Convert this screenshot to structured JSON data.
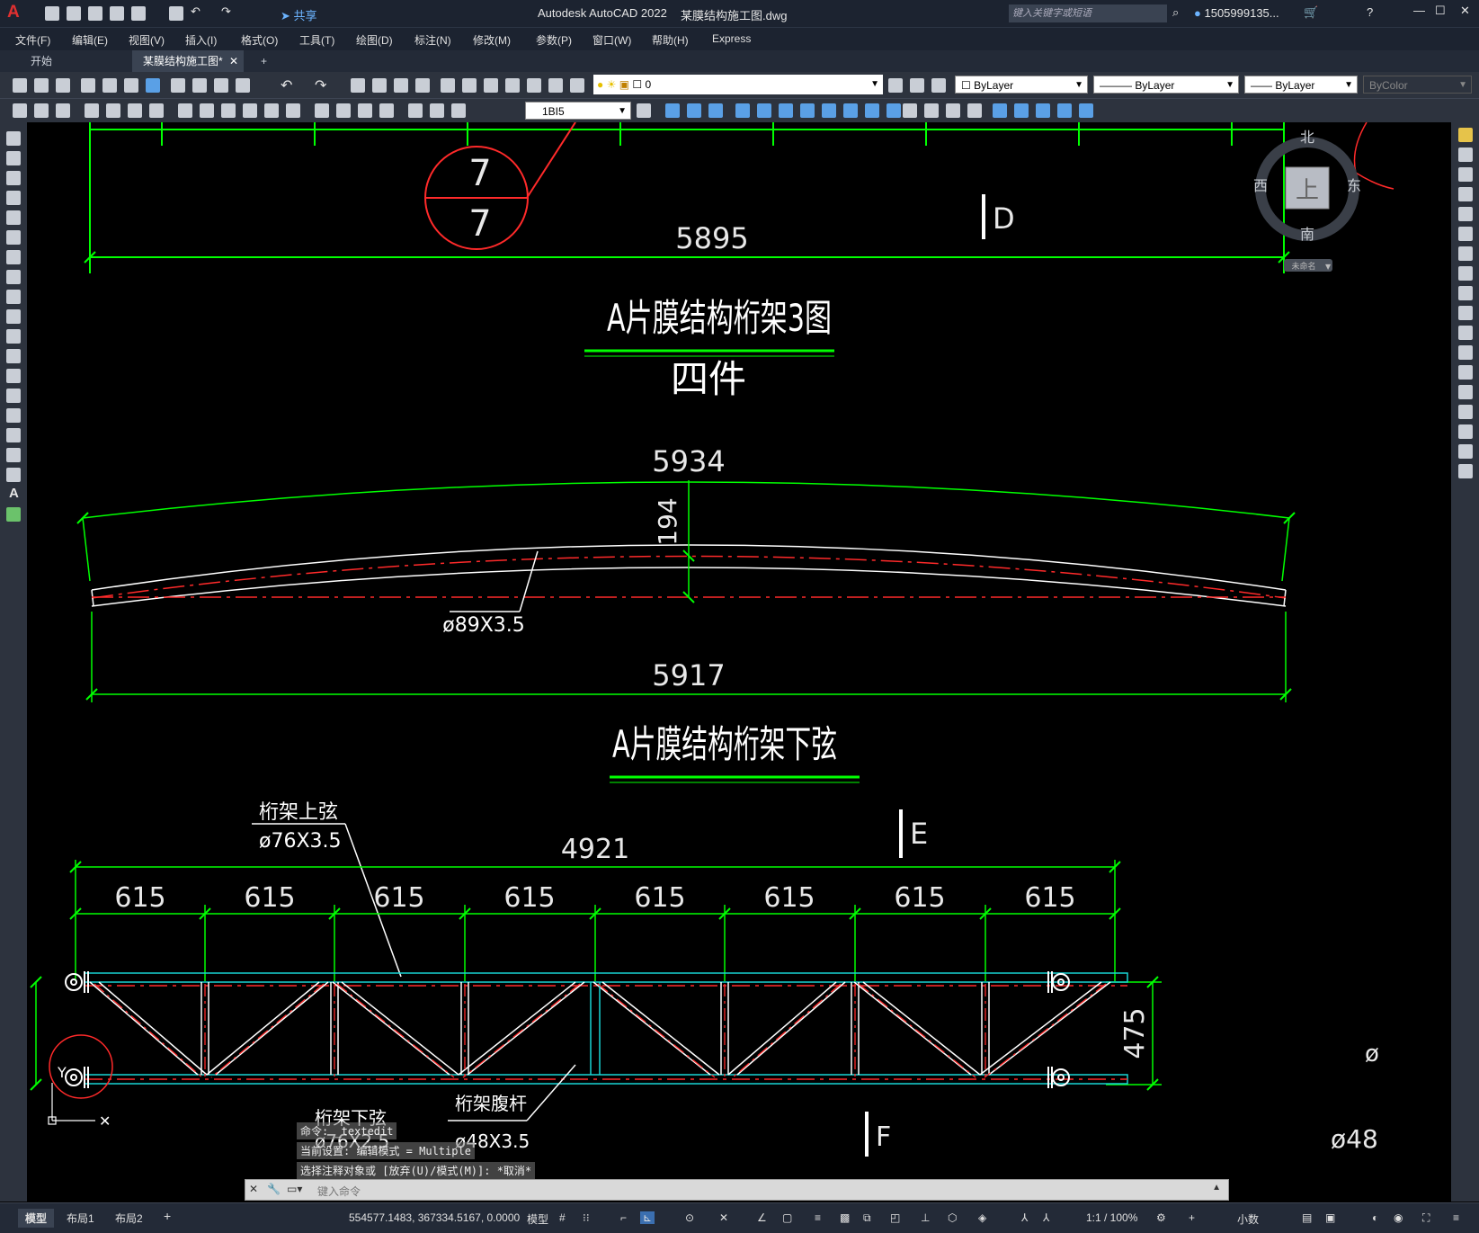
{
  "titlebar": {
    "app_title": "Autodesk AutoCAD 2022",
    "file_name": "某膜结构施工图.dwg",
    "search_placeholder": "键入关键字或短语",
    "user": "1505999135...",
    "share_label": "共享"
  },
  "menu": [
    "文件(F)",
    "编辑(E)",
    "视图(V)",
    "插入(I)",
    "格式(O)",
    "工具(T)",
    "绘图(D)",
    "标注(N)",
    "修改(M)",
    "参数(P)",
    "窗口(W)",
    "帮助(H)",
    "Express"
  ],
  "tabs": [
    {
      "label": "开始"
    },
    {
      "label": "某膜结构施工图*"
    }
  ],
  "toolbar": {
    "layer_value": "0",
    "color_value": "ByLayer",
    "linetype_value": "ByLayer",
    "lineweight_value": "ByLayer",
    "plotstyle_value": "ByColor",
    "dimstyle_value": "1BI5"
  },
  "viewcube": {
    "north": "北",
    "south": "南",
    "east": "东",
    "west": "西",
    "face": "上",
    "ucs_label": "未命名"
  },
  "drawing": {
    "colors": {
      "dim": "#00ff00",
      "center": "#ff2a2a",
      "member": "#ffffff",
      "chord": "#19d4d4",
      "leader": "#e8e8e8"
    },
    "top_dim": "5895",
    "callout_top": "7",
    "callout_bottom": "7",
    "section_d": "D",
    "title1": "A片膜结构桁架3图",
    "subtitle1": "四件",
    "arc_span_dim": "5934",
    "rise_dim": "194",
    "pipe_label": "ø89X3.5",
    "chord_len_dim": "5917",
    "title2": "A片膜结构桁架下弦",
    "top_chord_label": "桁架上弦",
    "top_chord_size": "ø76X3.5",
    "section_e": "E",
    "overall_dim": "4921",
    "panel_dims": [
      "615",
      "615",
      "615",
      "615",
      "615",
      "615",
      "615",
      "615"
    ],
    "height_dim": "475",
    "web_label": "桁架腹杆",
    "web_size": "ø48X3.5",
    "bottom_label": "桁架下弦",
    "bottom_size": "ø76X2.5",
    "section_f": "F",
    "edge_size": "ø48",
    "edge_ph": "ø"
  },
  "command": {
    "lines": [
      "命令: _textedit",
      "当前设置: 编辑模式 = Multiple",
      "选择注释对象或 [放弃(U)/模式(M)]: *取消*"
    ],
    "prompt_placeholder": "键入命令"
  },
  "layout_tabs": [
    "模型",
    "布局1",
    "布局2"
  ],
  "status": {
    "coords": "554577.1483, 367334.5167, 0.0000",
    "space": "模型",
    "scale": "1:1 / 100%",
    "units": "小数"
  }
}
